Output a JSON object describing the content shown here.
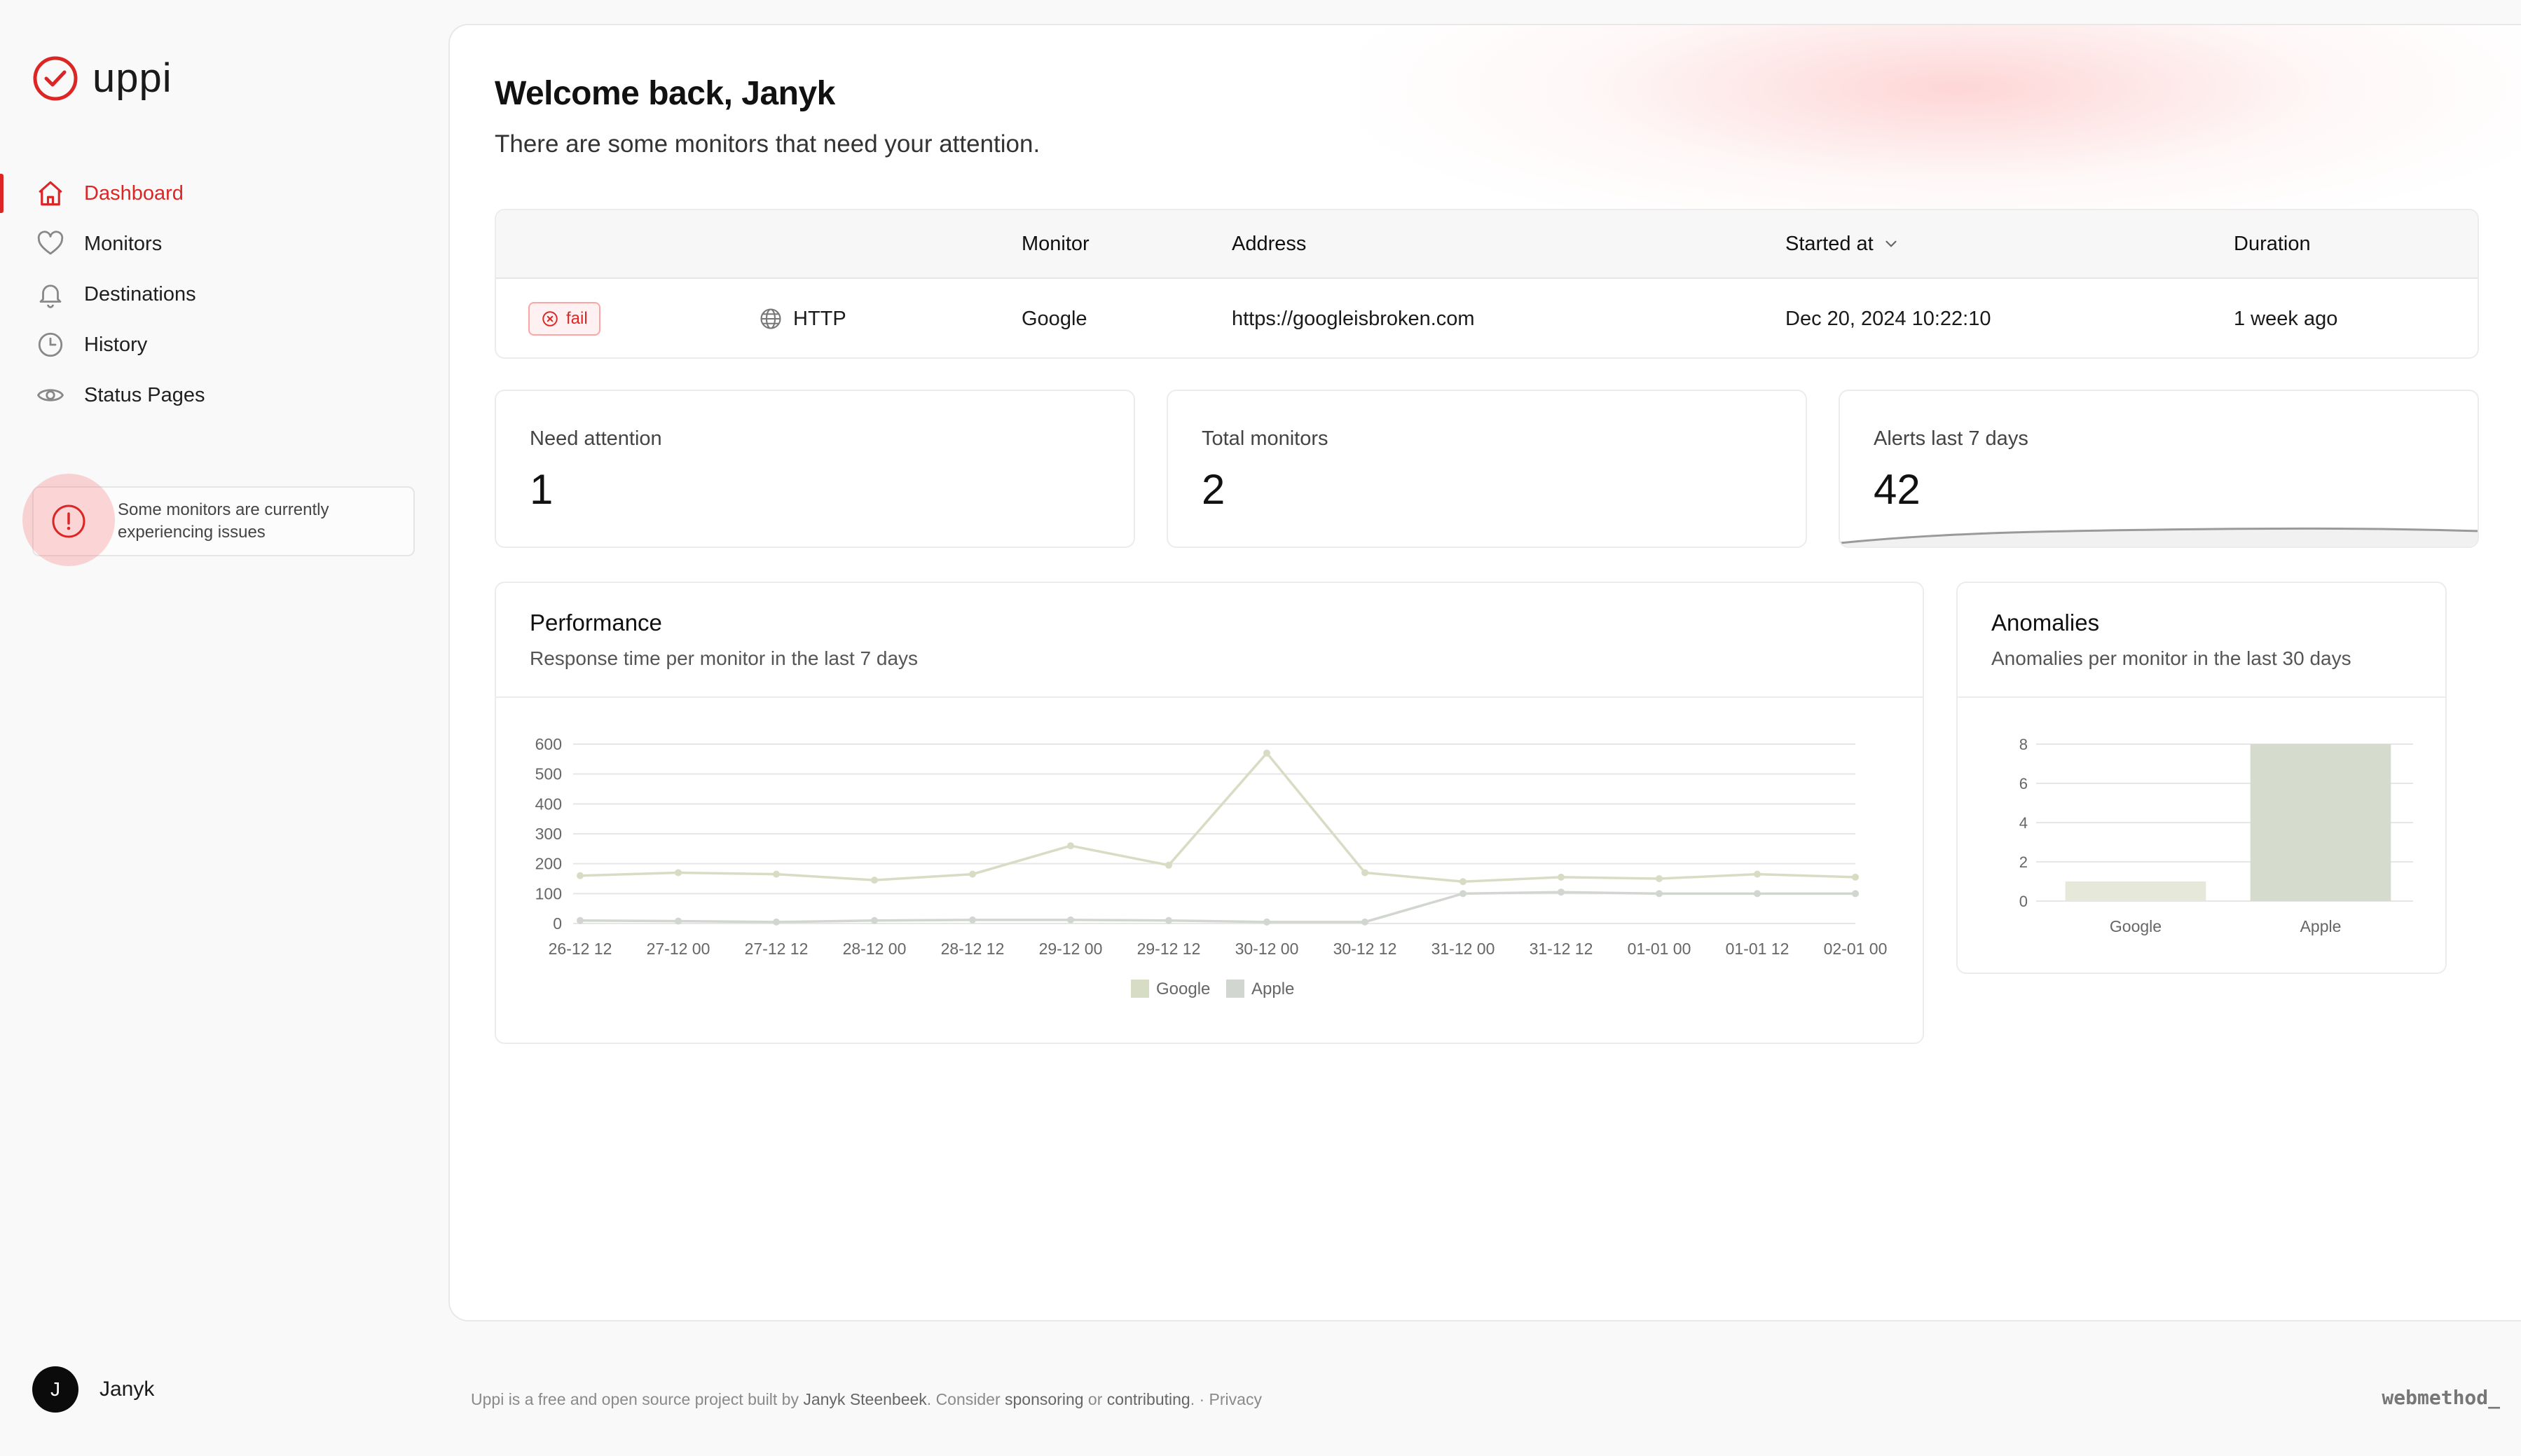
{
  "app": {
    "name": "uppi",
    "accent": "#dc2626"
  },
  "sidebar": {
    "items": [
      {
        "label": "Dashboard",
        "icon": "home-icon",
        "active": true
      },
      {
        "label": "Monitors",
        "icon": "heart-icon"
      },
      {
        "label": "Destinations",
        "icon": "bell-icon"
      },
      {
        "label": "History",
        "icon": "clock-icon"
      },
      {
        "label": "Status Pages",
        "icon": "eye-icon"
      }
    ],
    "alert": "Some monitors are currently experiencing issues",
    "user": {
      "initial": "J",
      "name": "Janyk"
    }
  },
  "main": {
    "title": "Welcome back, Janyk",
    "subtitle": "There are some monitors that need your attention.",
    "table": {
      "headers": {
        "monitor": "Monitor",
        "address": "Address",
        "started": "Started at",
        "duration": "Duration"
      },
      "rows": [
        {
          "status": "fail",
          "type": "HTTP",
          "monitor": "Google",
          "address": "https://googleisbroken.com",
          "started": "Dec 20, 2024 10:22:10",
          "duration": "1 week ago"
        }
      ]
    },
    "stats": [
      {
        "label": "Need attention",
        "value": "1"
      },
      {
        "label": "Total monitors",
        "value": "2"
      },
      {
        "label": "Alerts last 7 days",
        "value": "42"
      }
    ],
    "performance": {
      "title": "Performance",
      "subtitle": "Response time per monitor in the last 7 days"
    },
    "anomalies": {
      "title": "Anomalies",
      "subtitle": "Anomalies per monitor in the last 30 days"
    }
  },
  "chart_data": [
    {
      "type": "line",
      "x": [
        "26-12 12",
        "27-12 00",
        "27-12 12",
        "28-12 00",
        "28-12 12",
        "29-12 00",
        "29-12 12",
        "30-12 00",
        "30-12 12",
        "31-12 00",
        "31-12 12",
        "01-01 00",
        "01-01 12",
        "02-01 00"
      ],
      "ylim": [
        0,
        600
      ],
      "yticks": [
        0,
        100,
        200,
        300,
        400,
        500,
        600
      ],
      "series": [
        {
          "name": "Google",
          "color": "#d7ddc4",
          "values": [
            160,
            170,
            165,
            145,
            165,
            260,
            195,
            570,
            170,
            140,
            155,
            150,
            165,
            155
          ]
        },
        {
          "name": "Apple",
          "color": "#d2d6d0",
          "values": [
            10,
            8,
            5,
            10,
            12,
            12,
            10,
            5,
            5,
            100,
            105,
            100,
            100,
            100
          ]
        }
      ],
      "legend": "bottom"
    },
    {
      "type": "bar",
      "categories": [
        "Google",
        "Apple"
      ],
      "values": [
        1,
        8
      ],
      "colors": [
        "#e6e9d9",
        "#d5dccd"
      ],
      "ylim": [
        0,
        8
      ],
      "yticks": [
        0,
        2,
        4,
        6,
        8
      ]
    }
  ],
  "footer": {
    "t1": "Uppi is a free and open source project built by ",
    "author": "Janyk Steenbeek",
    "t2": ". Consider ",
    "sponsor": "sponsoring",
    "t3": " or ",
    "contrib": "contributing",
    "t4": ". · ",
    "privacy": "Privacy",
    "brand": "webmethod_"
  }
}
